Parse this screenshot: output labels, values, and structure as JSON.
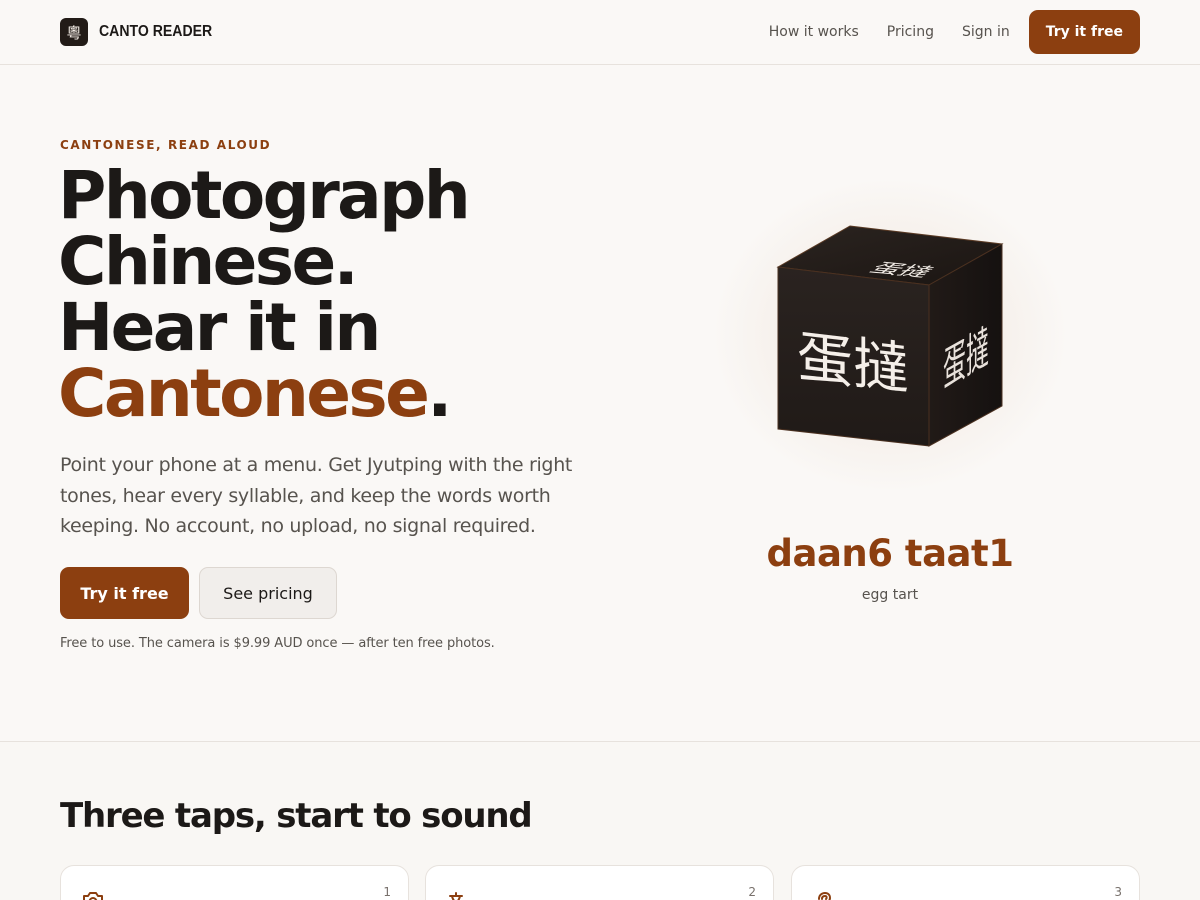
{
  "nav": {
    "logo_glyph": "粵",
    "brand": "CANTO READER",
    "links": [
      "How it works",
      "Pricing",
      "Sign in"
    ],
    "cta": "Try it free"
  },
  "hero": {
    "eyebrow": "CANTONESE, READ ALOUD",
    "headline_line1": "Photograph",
    "headline_line2": "Chinese.",
    "headline_line3": "Hear it in",
    "headline_accent": "Cantonese",
    "headline_period": ".",
    "lede": "Point your phone at a menu. Get Jyutping with the right tones, hear every syllable, and keep the words worth keeping. No account, no upload, no signal required.",
    "primary_button": "Try it free",
    "secondary_button": "See pricing",
    "fineprint": "Free to use. The camera is $9.99 AUD once — after ten free photos."
  },
  "showcase": {
    "chinese": "蛋撻",
    "jyutping": "daan6 taat1",
    "gloss": "egg tart"
  },
  "steps_section": {
    "title": "Three taps, start to sound",
    "steps": [
      {
        "number": "1",
        "icon": "camera-icon"
      },
      {
        "number": "2",
        "icon": "translate-icon"
      },
      {
        "number": "3",
        "icon": "ear-icon"
      }
    ]
  },
  "colors": {
    "accent": "#8c3f10",
    "background": "#faf8f6",
    "text": "#1c1917",
    "muted": "#57534e",
    "cube": "#221b17"
  }
}
